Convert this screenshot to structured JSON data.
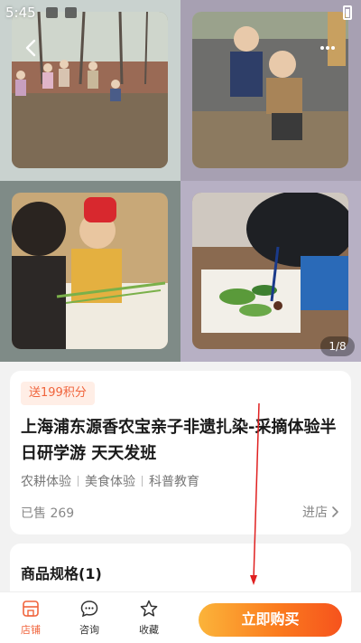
{
  "status_bar": {
    "time": "5:45"
  },
  "gallery": {
    "pager": "1/8"
  },
  "product": {
    "points_badge": "送199积分",
    "title": "上海浦东源香农宝亲子非遗扎染-采摘体验半日研学游 天天发班",
    "tags": [
      "农耕体验",
      "美食体验",
      "科普教育"
    ],
    "sold": "已售 269",
    "enter_shop": "进店"
  },
  "spec": {
    "title": "商品规格(1)"
  },
  "bottom_bar": {
    "store": "店铺",
    "consult": "咨询",
    "favorite": "收藏",
    "buy": "立即购买"
  },
  "colors": {
    "accent": "#f0643c",
    "buy_gradient_start": "#fbb43a",
    "buy_gradient_end": "#f6531d",
    "annotation_arrow": "#e02020"
  }
}
